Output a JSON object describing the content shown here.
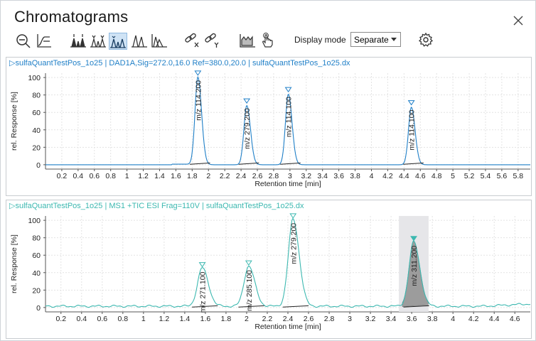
{
  "window": {
    "title": "Chromatograms"
  },
  "toolbar": {
    "display_mode_label": "Display mode",
    "display_mode_value": "Separate",
    "buttons": [
      "zoom-out-icon",
      "autoscale-icon",
      "peak-labels-icon",
      "peak-labels-alt-icon",
      "overlay-peaks-icon",
      "peak-stack-icon",
      "peak-separate-icon",
      "unlink-x-icon",
      "unlink-y-icon",
      "integration-icon",
      "touch-hand-icon",
      "settings-icon"
    ]
  },
  "panels": [
    {
      "header": "sulfaQuantTestPos_1o25 | DAD1A,Sig=272.0,16.0  Ref=380.0,20.0 | sulfaQuantTestPos_1o25.dx",
      "color": "#1f7fc7",
      "chart_data": {
        "type": "line",
        "xlabel": "Retention time [min]",
        "ylabel": "rel. Response [%]",
        "xlim": [
          0.0,
          5.95
        ],
        "ylim": [
          -5,
          105
        ],
        "x_ticks": [
          "0.2",
          "0.4",
          "0.6",
          "0.8",
          "1",
          "1.2",
          "1.4",
          "1.6",
          "1.8",
          "2",
          "2.2",
          "2.4",
          "2.6",
          "2.8",
          "3",
          "3.2",
          "3.4",
          "3.6",
          "3.8",
          "4",
          "4.2",
          "4.4",
          "4.6",
          "4.8",
          "5",
          "5.2",
          "5.4",
          "5.6",
          "5.8"
        ],
        "y_ticks": [
          "0",
          "20",
          "40",
          "60",
          "80",
          "100"
        ],
        "peaks": [
          {
            "rt": 1.87,
            "height": 100,
            "label": "m/z 114.200"
          },
          {
            "rt": 2.47,
            "height": 68,
            "label": "m/z 279.200"
          },
          {
            "rt": 2.98,
            "height": 81,
            "label": "m/z 114.100"
          },
          {
            "rt": 4.49,
            "height": 66,
            "label": "m/z 114.100"
          }
        ]
      }
    },
    {
      "header": "sulfaQuantTestPos_1o25 | MS1  +TIC ESI Frag=110V | sulfaQuantTestPos_1o25.dx",
      "color": "#3cb8b0",
      "chart_data": {
        "type": "line",
        "xlabel": "Retention time [min]",
        "ylabel": "rel. Response [%]",
        "xlim": [
          0.05,
          4.75
        ],
        "ylim": [
          -5,
          105
        ],
        "x_ticks": [
          "0.2",
          "0.4",
          "0.6",
          "0.8",
          "1",
          "1.2",
          "1.4",
          "1.6",
          "1.8",
          "2",
          "2.2",
          "2.4",
          "2.6",
          "2.8",
          "3",
          "3.2",
          "3.4",
          "3.6",
          "3.8",
          "4",
          "4.2",
          "4.4",
          "4.6"
        ],
        "y_ticks": [
          "0",
          "20",
          "40",
          "60",
          "80",
          "100"
        ],
        "peaks": [
          {
            "rt": 1.57,
            "height": 44,
            "label": "m/z 271.100"
          },
          {
            "rt": 2.02,
            "height": 46,
            "label": "m/z 285.100"
          },
          {
            "rt": 2.45,
            "height": 100,
            "label": "m/z 279.200"
          },
          {
            "rt": 3.62,
            "height": 74,
            "label": "m/z 311.200",
            "selected": true
          }
        ]
      }
    }
  ]
}
